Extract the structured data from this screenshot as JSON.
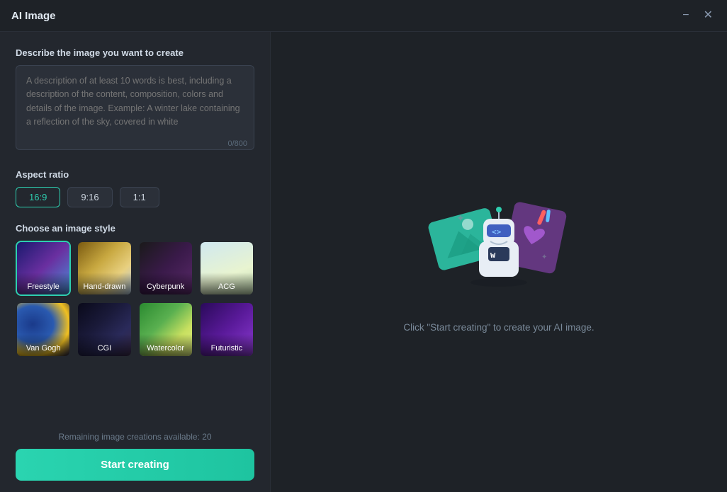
{
  "window": {
    "title": "AI Image",
    "minimize_label": "−",
    "close_label": "✕"
  },
  "left": {
    "description_label": "Describe the image you want to create",
    "textarea_placeholder": "A description of at least 10 words is best, including a description of the content, composition, colors and details of the image. Example: A winter lake containing a reflection of the sky, covered in white",
    "char_count": "0/800",
    "aspect_ratio_label": "Aspect ratio",
    "ratios": [
      {
        "id": "16:9",
        "label": "16:9",
        "active": true
      },
      {
        "id": "9:16",
        "label": "9:16",
        "active": false
      },
      {
        "id": "1:1",
        "label": "1:1",
        "active": false
      }
    ],
    "style_label": "Choose an image style",
    "styles": [
      {
        "id": "freestyle",
        "label": "Freestyle",
        "selected": true
      },
      {
        "id": "handdrawn",
        "label": "Hand-drawn",
        "selected": false
      },
      {
        "id": "cyberpunk",
        "label": "Cyberpunk",
        "selected": false
      },
      {
        "id": "acg",
        "label": "ACG",
        "selected": false
      },
      {
        "id": "vangogh",
        "label": "Van Gogh",
        "selected": false
      },
      {
        "id": "cgi",
        "label": "CGI",
        "selected": false
      },
      {
        "id": "watercolor",
        "label": "Watercolor",
        "selected": false
      },
      {
        "id": "futuristic",
        "label": "Futuristic",
        "selected": false
      }
    ],
    "remaining_text": "Remaining image creations available: 20",
    "start_btn_label": "Start creating"
  },
  "right": {
    "hint": "Click \"Start creating\" to create your AI image."
  }
}
